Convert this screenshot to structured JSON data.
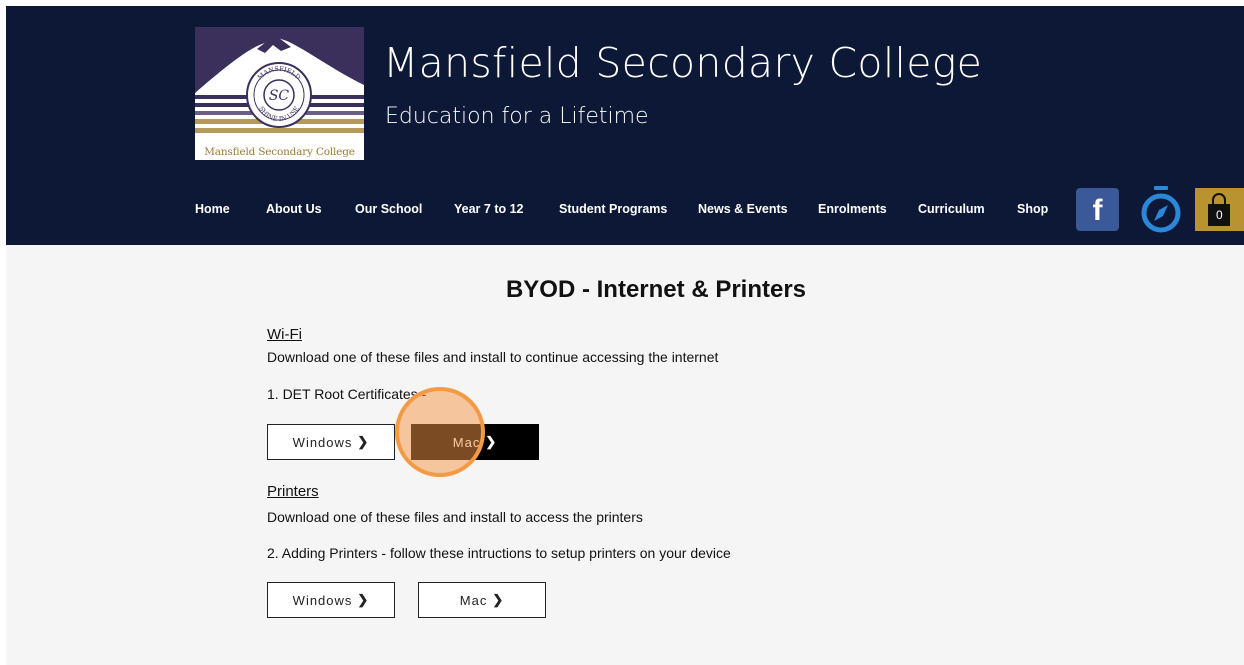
{
  "header": {
    "logo_caption": "Mansfield Secondary College",
    "seal_text_top": "MANSFIELD",
    "seal_text_bottom": "SHINE IN USE",
    "seal_monogram": "SC",
    "title": "Mansfield Secondary College",
    "tagline": "Education for a Lifetime"
  },
  "nav": {
    "items": [
      {
        "label": "Home"
      },
      {
        "label": "About Us"
      },
      {
        "label": "Our School"
      },
      {
        "label": "Year 7 to 12"
      },
      {
        "label": "Student Programs"
      },
      {
        "label": "News & Events"
      },
      {
        "label": "Enrolments"
      },
      {
        "label": "Curriculum"
      },
      {
        "label": "Shop"
      }
    ],
    "facebook_glyph": "f",
    "cart_count": "0"
  },
  "main": {
    "title": "BYOD - Internet & Printers",
    "wifi": {
      "heading": "Wi-Fi",
      "description": "Download one of these files and install to continue accessing the internet",
      "item": "1. DET Root Certificates -",
      "windows_label": "Windows",
      "mac_label": "Mac"
    },
    "printers": {
      "heading": "Printers",
      "description": "Download one of these files and install to access the printers",
      "item": "2. Adding Printers - follow these intructions to setup printers on your device",
      "windows_label": "Windows",
      "mac_label": "Mac"
    }
  },
  "colors": {
    "header_bg": "#0c1836",
    "page_bg": "#f5f5f5",
    "facebook": "#3b5998",
    "compass": "#2b88d8",
    "cart": "#b8932f",
    "click_indicator": "#f39a44"
  },
  "icons": [
    "facebook-icon",
    "compass-icon",
    "shopping-bag-icon",
    "chevron-right-icon"
  ]
}
